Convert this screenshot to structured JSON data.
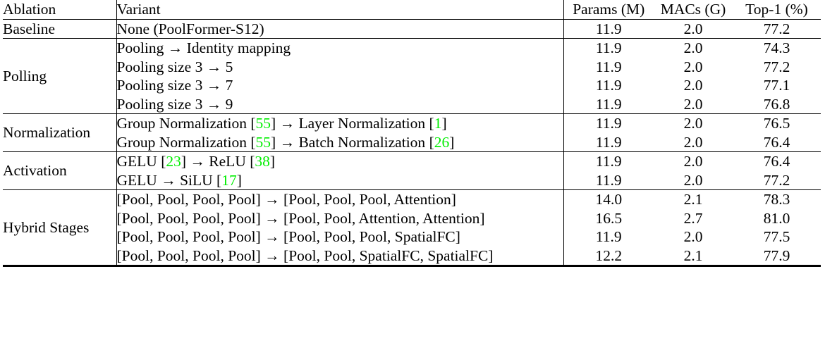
{
  "table": {
    "headers": {
      "ablation": "Ablation",
      "variant": "Variant",
      "params": "Params (M)",
      "macs": "MACs (G)",
      "top1": "Top-1 (%)"
    },
    "accent_citation_color": "#00ee00",
    "arrow": "→",
    "sections": [
      {
        "ablation": "Baseline",
        "rows": [
          {
            "variant_parts": [
              {
                "text": "None (PoolFormer-S12)",
                "type": "plain"
              }
            ],
            "variant_text": "None (PoolFormer-S12)",
            "params": "11.9",
            "macs": "2.0",
            "top1": "77.2"
          }
        ]
      },
      {
        "ablation": "Polling",
        "rows": [
          {
            "variant_parts": [
              {
                "text": "Pooling → Identity mapping",
                "type": "plain"
              }
            ],
            "variant_text": "Pooling → Identity mapping",
            "params": "11.9",
            "macs": "2.0",
            "top1": "74.3"
          },
          {
            "variant_parts": [
              {
                "text": "Pooling size 3 → 5",
                "type": "plain"
              }
            ],
            "variant_text": "Pooling size 3 → 5",
            "params": "11.9",
            "macs": "2.0",
            "top1": "77.2"
          },
          {
            "variant_parts": [
              {
                "text": "Pooling size 3 → 7",
                "type": "plain"
              }
            ],
            "variant_text": "Pooling size 3 → 7",
            "params": "11.9",
            "macs": "2.0",
            "top1": "77.1"
          },
          {
            "variant_parts": [
              {
                "text": "Pooling size 3 → 9",
                "type": "plain"
              }
            ],
            "variant_text": "Pooling size 3 → 9",
            "params": "11.9",
            "macs": "2.0",
            "top1": "76.8"
          }
        ]
      },
      {
        "ablation": "Normalization",
        "rows": [
          {
            "variant_parts": [
              {
                "text": "Group Normalization ",
                "type": "plain"
              },
              {
                "text": "55",
                "type": "cite"
              },
              {
                "text": " → Layer Normalization ",
                "type": "plain"
              },
              {
                "text": "1",
                "type": "cite"
              }
            ],
            "variant_text": "Group Normalization [55] → Layer Normalization [1]",
            "params": "11.9",
            "macs": "2.0",
            "top1": "76.5"
          },
          {
            "variant_parts": [
              {
                "text": "Group Normalization ",
                "type": "plain"
              },
              {
                "text": "55",
                "type": "cite"
              },
              {
                "text": " → Batch Normalization ",
                "type": "plain"
              },
              {
                "text": "26",
                "type": "cite"
              }
            ],
            "variant_text": "Group Normalization [55] → Batch Normalization [26]",
            "params": "11.9",
            "macs": "2.0",
            "top1": "76.4"
          }
        ]
      },
      {
        "ablation": "Activation",
        "rows": [
          {
            "variant_parts": [
              {
                "text": "GELU ",
                "type": "plain"
              },
              {
                "text": "23",
                "type": "cite"
              },
              {
                "text": " → ReLU ",
                "type": "plain"
              },
              {
                "text": "38",
                "type": "cite"
              }
            ],
            "variant_text": "GELU [23] → ReLU [38]",
            "params": "11.9",
            "macs": "2.0",
            "top1": "76.4"
          },
          {
            "variant_parts": [
              {
                "text": "GELU → SiLU ",
                "type": "plain"
              },
              {
                "text": "17",
                "type": "cite"
              }
            ],
            "variant_text": "GELU → SiLU [17]",
            "params": "11.9",
            "macs": "2.0",
            "top1": "77.2"
          }
        ]
      },
      {
        "ablation": "Hybrid Stages",
        "rows": [
          {
            "variant_parts": [
              {
                "text": "[Pool, Pool, Pool, Pool] → [Pool, Pool, Pool, Attention]",
                "type": "plain"
              }
            ],
            "variant_text": "[Pool, Pool, Pool, Pool] → [Pool, Pool, Pool, Attention]",
            "params": "14.0",
            "macs": "2.1",
            "top1": "78.3"
          },
          {
            "variant_parts": [
              {
                "text": "[Pool, Pool, Pool, Pool] → [Pool, Pool, Attention, Attention]",
                "type": "plain"
              }
            ],
            "variant_text": "[Pool, Pool, Pool, Pool] → [Pool, Pool, Attention, Attention]",
            "params": "16.5",
            "macs": "2.7",
            "top1": "81.0"
          },
          {
            "variant_parts": [
              {
                "text": "[Pool, Pool, Pool, Pool] → [Pool, Pool, Pool, SpatialFC]",
                "type": "plain"
              }
            ],
            "variant_text": "[Pool, Pool, Pool, Pool] → [Pool, Pool, Pool, SpatialFC]",
            "params": "11.9",
            "macs": "2.0",
            "top1": "77.5"
          },
          {
            "variant_parts": [
              {
                "text": "[Pool, Pool, Pool, Pool] → [Pool, Pool, SpatialFC, SpatialFC]",
                "type": "plain"
              }
            ],
            "variant_text": "[Pool, Pool, Pool, Pool] → [Pool, Pool, SpatialFC, SpatialFC]",
            "params": "12.2",
            "macs": "2.1",
            "top1": "77.9"
          }
        ]
      }
    ]
  }
}
